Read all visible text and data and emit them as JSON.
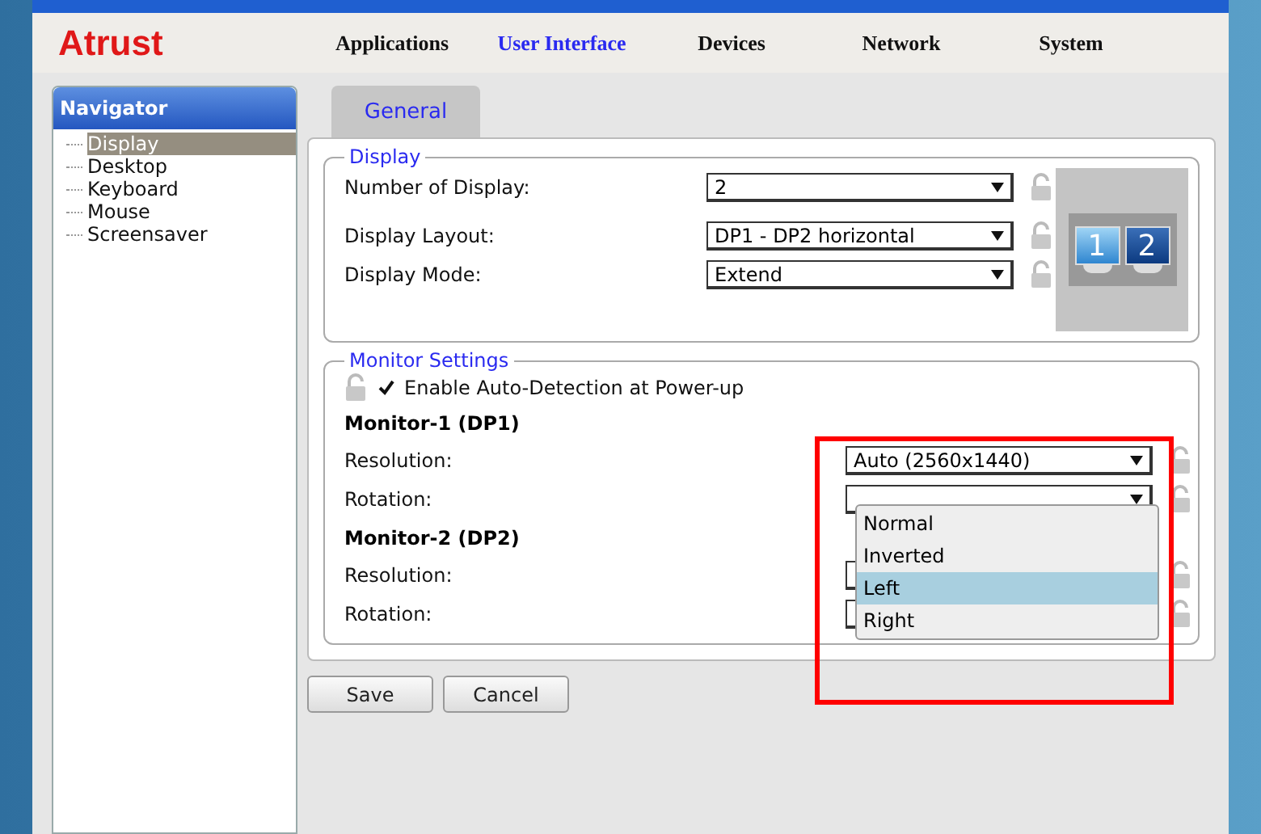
{
  "logo": "Atrust",
  "menu": [
    {
      "label": "Applications",
      "selected": false
    },
    {
      "label": "User Interface",
      "selected": true
    },
    {
      "label": "Devices",
      "selected": false
    },
    {
      "label": "Network",
      "selected": false
    },
    {
      "label": "System",
      "selected": false
    }
  ],
  "navigator": {
    "title": "Navigator",
    "items": [
      {
        "label": "Display",
        "selected": true
      },
      {
        "label": "Desktop",
        "selected": false
      },
      {
        "label": "Keyboard",
        "selected": false
      },
      {
        "label": "Mouse",
        "selected": false
      },
      {
        "label": "Screensaver",
        "selected": false
      }
    ]
  },
  "tabs": [
    {
      "label": "General",
      "selected": true
    }
  ],
  "display_group": {
    "title": "Display",
    "fields": [
      {
        "label": "Number of Display:",
        "value": "2"
      },
      {
        "label": "Display Layout:",
        "value": "DP1 - DP2 horizontal"
      },
      {
        "label": "Display Mode:",
        "value": "Extend"
      }
    ],
    "preview": [
      "1",
      "2"
    ]
  },
  "monitor_settings": {
    "title": "Monitor Settings",
    "auto_detect": {
      "label": "Enable Auto-Detection at Power-up",
      "checked": true
    },
    "monitors": [
      {
        "title": "Monitor-1 (DP1)",
        "fields": [
          {
            "label": "Resolution:",
            "value": "Auto (2560x1440)"
          },
          {
            "label": "Rotation:"
          }
        ]
      },
      {
        "title": "Monitor-2 (DP2)",
        "fields": [
          {
            "label": "Resolution:"
          },
          {
            "label": "Rotation:"
          }
        ]
      }
    ]
  },
  "dropdown_list": {
    "options": [
      {
        "label": "Normal",
        "selected": false
      },
      {
        "label": "Inverted",
        "selected": false
      },
      {
        "label": "Left",
        "selected": true
      },
      {
        "label": "Right",
        "selected": false
      }
    ]
  },
  "buttons": [
    "Save",
    "Cancel"
  ]
}
